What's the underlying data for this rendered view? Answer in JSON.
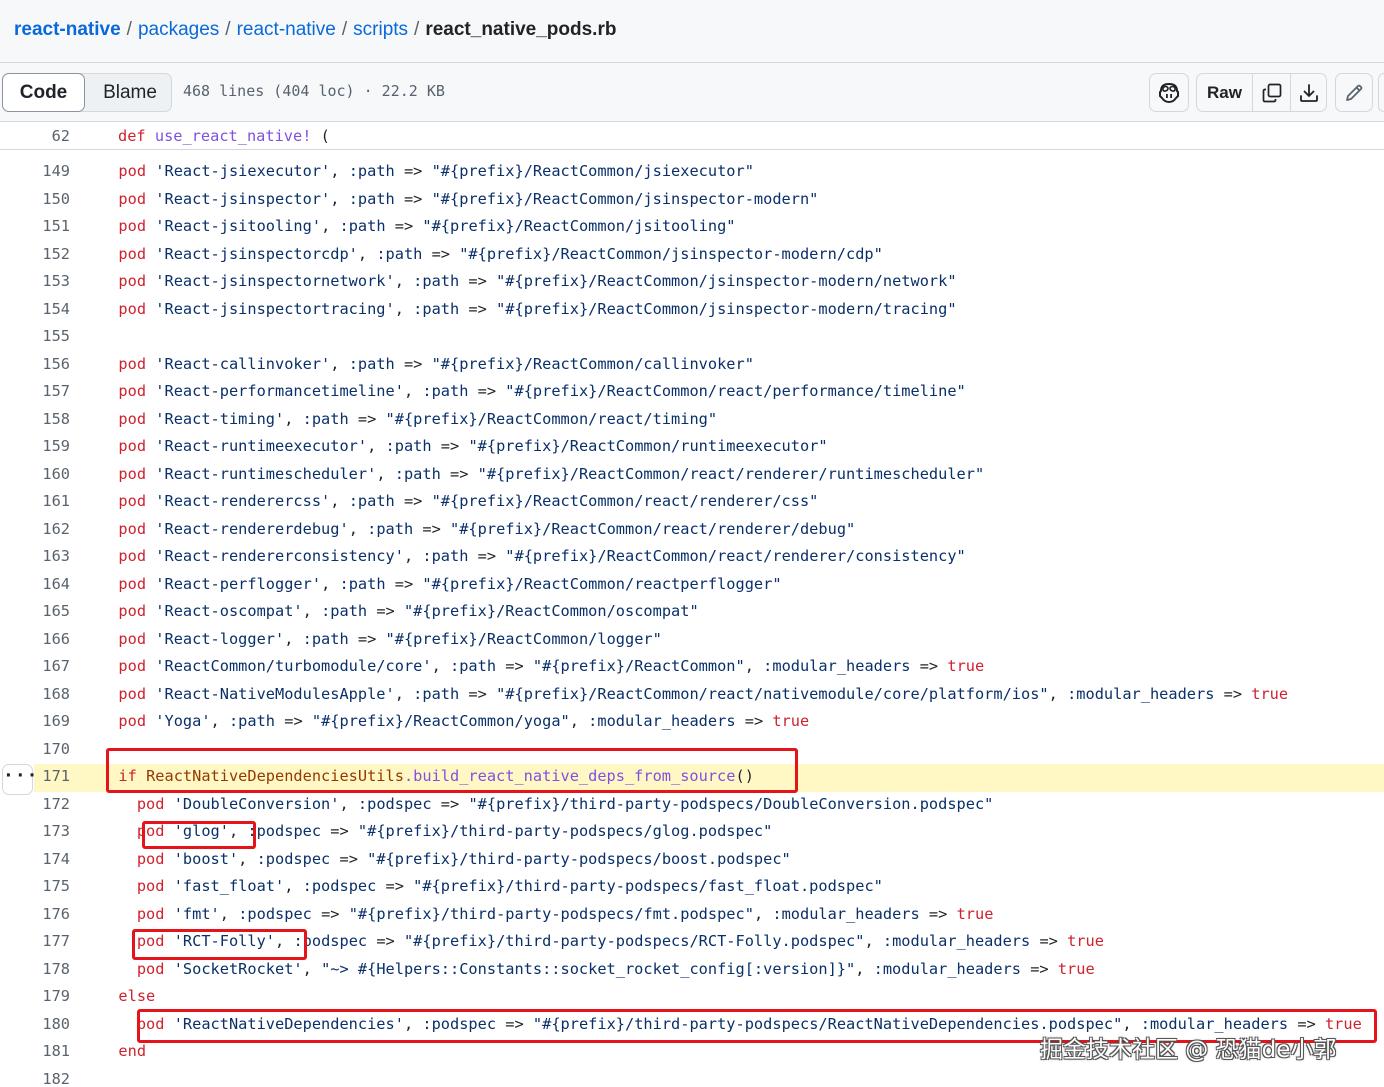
{
  "breadcrumb": {
    "repo": "react-native",
    "parts": [
      "packages",
      "react-native",
      "scripts"
    ],
    "file": "react_native_pods.rb"
  },
  "toolbar": {
    "tabs": {
      "code": "Code",
      "blame": "Blame"
    },
    "file_info": "468 lines (404 loc) · 22.2 KB",
    "raw_label": "Raw",
    "icons": [
      "copilot-icon",
      "copy-icon",
      "download-icon",
      "pencil-icon"
    ]
  },
  "code": {
    "sticky": {
      "number": "62",
      "text": "def use_react_native! ("
    },
    "lines": [
      {
        "n": "149",
        "t": "  pod 'React-jsiexecutor', :path => \"#{prefix}/ReactCommon/jsiexecutor\""
      },
      {
        "n": "150",
        "t": "  pod 'React-jsinspector', :path => \"#{prefix}/ReactCommon/jsinspector-modern\""
      },
      {
        "n": "151",
        "t": "  pod 'React-jsitooling', :path => \"#{prefix}/ReactCommon/jsitooling\""
      },
      {
        "n": "152",
        "t": "  pod 'React-jsinspectorcdp', :path => \"#{prefix}/ReactCommon/jsinspector-modern/cdp\""
      },
      {
        "n": "153",
        "t": "  pod 'React-jsinspectornetwork', :path => \"#{prefix}/ReactCommon/jsinspector-modern/network\""
      },
      {
        "n": "154",
        "t": "  pod 'React-jsinspectortracing', :path => \"#{prefix}/ReactCommon/jsinspector-modern/tracing\""
      },
      {
        "n": "155",
        "t": ""
      },
      {
        "n": "156",
        "t": "  pod 'React-callinvoker', :path => \"#{prefix}/ReactCommon/callinvoker\""
      },
      {
        "n": "157",
        "t": "  pod 'React-performancetimeline', :path => \"#{prefix}/ReactCommon/react/performance/timeline\""
      },
      {
        "n": "158",
        "t": "  pod 'React-timing', :path => \"#{prefix}/ReactCommon/react/timing\""
      },
      {
        "n": "159",
        "t": "  pod 'React-runtimeexecutor', :path => \"#{prefix}/ReactCommon/runtimeexecutor\""
      },
      {
        "n": "160",
        "t": "  pod 'React-runtimescheduler', :path => \"#{prefix}/ReactCommon/react/renderer/runtimescheduler\""
      },
      {
        "n": "161",
        "t": "  pod 'React-renderercss', :path => \"#{prefix}/ReactCommon/react/renderer/css\""
      },
      {
        "n": "162",
        "t": "  pod 'React-rendererdebug', :path => \"#{prefix}/ReactCommon/react/renderer/debug\""
      },
      {
        "n": "163",
        "t": "  pod 'React-rendererconsistency', :path => \"#{prefix}/ReactCommon/react/renderer/consistency\""
      },
      {
        "n": "164",
        "t": "  pod 'React-perflogger', :path => \"#{prefix}/ReactCommon/reactperflogger\""
      },
      {
        "n": "165",
        "t": "  pod 'React-oscompat', :path => \"#{prefix}/ReactCommon/oscompat\""
      },
      {
        "n": "166",
        "t": "  pod 'React-logger', :path => \"#{prefix}/ReactCommon/logger\""
      },
      {
        "n": "167",
        "t": "  pod 'ReactCommon/turbomodule/core', :path => \"#{prefix}/ReactCommon\", :modular_headers => true"
      },
      {
        "n": "168",
        "t": "  pod 'React-NativeModulesApple', :path => \"#{prefix}/ReactCommon/react/nativemodule/core/platform/ios\", :modular_headers => true"
      },
      {
        "n": "169",
        "t": "  pod 'Yoga', :path => \"#{prefix}/ReactCommon/yoga\", :modular_headers => true"
      },
      {
        "n": "170",
        "t": ""
      },
      {
        "n": "171",
        "t": "  if ReactNativeDependenciesUtils.build_react_native_deps_from_source()"
      },
      {
        "n": "172",
        "t": "    pod 'DoubleConversion', :podspec => \"#{prefix}/third-party-podspecs/DoubleConversion.podspec\""
      },
      {
        "n": "173",
        "t": "    pod 'glog', :podspec => \"#{prefix}/third-party-podspecs/glog.podspec\""
      },
      {
        "n": "174",
        "t": "    pod 'boost', :podspec => \"#{prefix}/third-party-podspecs/boost.podspec\""
      },
      {
        "n": "175",
        "t": "    pod 'fast_float', :podspec => \"#{prefix}/third-party-podspecs/fast_float.podspec\""
      },
      {
        "n": "176",
        "t": "    pod 'fmt', :podspec => \"#{prefix}/third-party-podspecs/fmt.podspec\", :modular_headers => true"
      },
      {
        "n": "177",
        "t": "    pod 'RCT-Folly', :podspec => \"#{prefix}/third-party-podspecs/RCT-Folly.podspec\", :modular_headers => true"
      },
      {
        "n": "178",
        "t": "    pod 'SocketRocket', \"~> #{Helpers::Constants::socket_rocket_config[:version]}\", :modular_headers => true"
      },
      {
        "n": "179",
        "t": "  else"
      },
      {
        "n": "180",
        "t": "    pod 'ReactNativeDependencies', :podspec => \"#{prefix}/third-party-podspecs/ReactNativeDependencies.podspec\", :modular_headers => true"
      },
      {
        "n": "181",
        "t": "  end"
      },
      {
        "n": "182",
        "t": ""
      }
    ],
    "highlighted_line": "171"
  },
  "watermark": "掘金技术社区 @ 恐猫de小郭"
}
